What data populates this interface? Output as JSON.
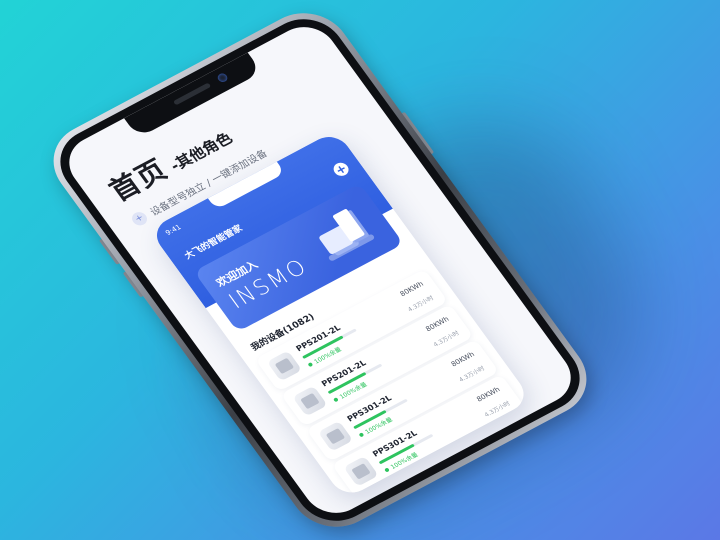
{
  "hero": {
    "title": "首页",
    "subtitle": "-其他角色",
    "desc_icon": "plus-icon",
    "description": "设备型号独立 / 一键添加设备"
  },
  "app": {
    "status_time": "9:41",
    "status_signal": "",
    "user_title": "大飞的智能管家",
    "add_icon": "plus-circle-icon",
    "banner": {
      "title": "欢迎加入",
      "brand": "INSMO"
    },
    "devices_heading": "我的设备(1082)",
    "devices": [
      {
        "name": "PPS201-2L",
        "value": "80KWh",
        "progress": 0.75,
        "status": "100%余量",
        "meta": "4.3万小时"
      },
      {
        "name": "PPS201-2L",
        "value": "80KWh",
        "progress": 0.7,
        "status": "100%余量",
        "meta": "4.3万小时"
      },
      {
        "name": "PPS301-2L",
        "value": "80KWh",
        "progress": 0.6,
        "status": "100%余量",
        "meta": "4.3万小时"
      },
      {
        "name": "PPS301-2L",
        "value": "80KWh",
        "progress": 0.65,
        "status": "100%余量",
        "meta": "4.3万小时"
      }
    ]
  },
  "colors": {
    "primary": "#2f5fe0",
    "success": "#2ec45f",
    "background_start": "#22d3d6",
    "background_end": "#5b78e6"
  }
}
